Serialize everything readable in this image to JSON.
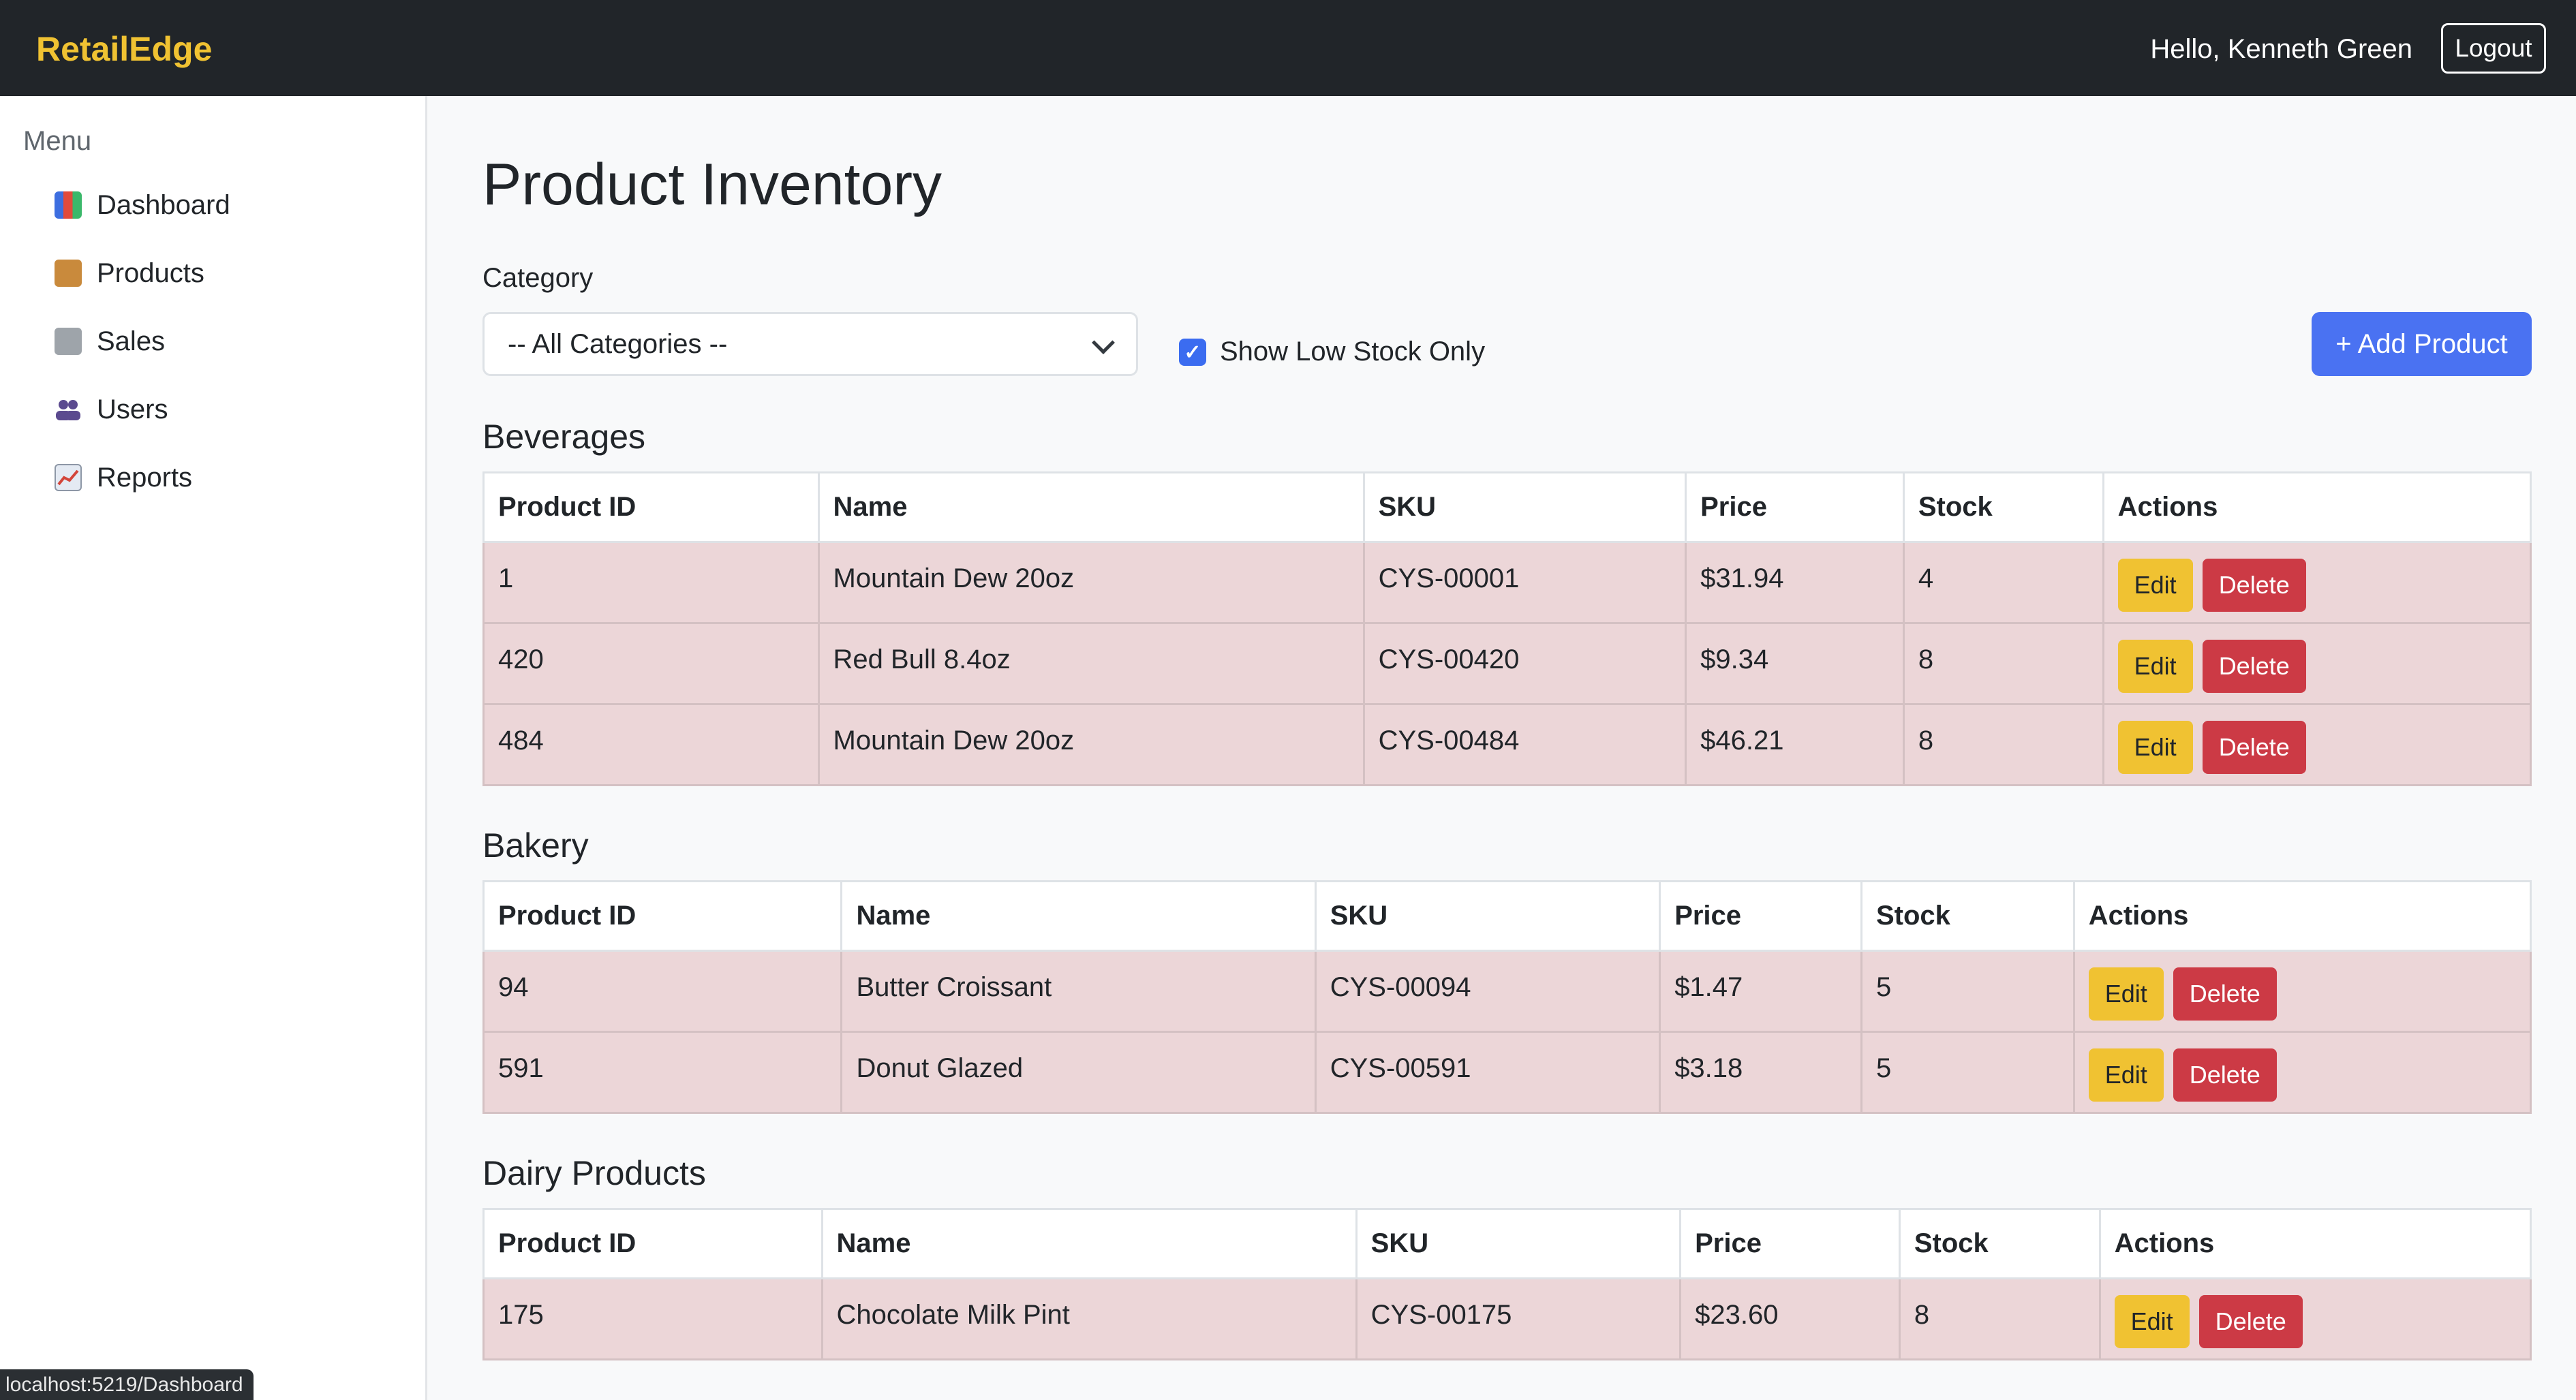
{
  "app": {
    "brand": "RetailEdge",
    "greeting": "Hello, Kenneth Green",
    "logout_label": "Logout"
  },
  "sidebar": {
    "menu_title": "Menu",
    "items": [
      {
        "label": "Dashboard",
        "icon": "bar-chart-icon"
      },
      {
        "label": "Products",
        "icon": "package-icon"
      },
      {
        "label": "Sales",
        "icon": "receipt-icon"
      },
      {
        "label": "Users",
        "icon": "users-icon"
      },
      {
        "label": "Reports",
        "icon": "trend-chart-icon"
      }
    ]
  },
  "main": {
    "title": "Product Inventory",
    "category_label": "Category",
    "category_selected": "-- All Categories --",
    "low_stock_label": "Show Low Stock Only",
    "low_stock_checked": true,
    "add_button_label": "+ Add Product",
    "columns": [
      "Product ID",
      "Name",
      "SKU",
      "Price",
      "Stock",
      "Actions"
    ],
    "edit_label": "Edit",
    "delete_label": "Delete",
    "sections": [
      {
        "title": "Beverages",
        "rows": [
          {
            "id": "1",
            "name": "Mountain Dew 20oz",
            "sku": "CYS-00001",
            "price": "$31.94",
            "stock": "4"
          },
          {
            "id": "420",
            "name": "Red Bull 8.4oz",
            "sku": "CYS-00420",
            "price": "$9.34",
            "stock": "8"
          },
          {
            "id": "484",
            "name": "Mountain Dew 20oz",
            "sku": "CYS-00484",
            "price": "$46.21",
            "stock": "8"
          }
        ]
      },
      {
        "title": "Bakery",
        "rows": [
          {
            "id": "94",
            "name": "Butter Croissant",
            "sku": "CYS-00094",
            "price": "$1.47",
            "stock": "5"
          },
          {
            "id": "591",
            "name": "Donut Glazed",
            "sku": "CYS-00591",
            "price": "$3.18",
            "stock": "5"
          }
        ]
      },
      {
        "title": "Dairy Products",
        "rows": [
          {
            "id": "175",
            "name": "Chocolate Milk Pint",
            "sku": "CYS-00175",
            "price": "$23.60",
            "stock": "8"
          }
        ]
      }
    ]
  },
  "status_bar": {
    "url": "localhost:5219/Dashboard"
  },
  "colors": {
    "topbar": "#212529",
    "brand": "#f0c232",
    "primary": "#4a72f2",
    "edit": "#f0c232",
    "delete": "#cc3a45",
    "row_highlight": "#ecd6d8"
  }
}
